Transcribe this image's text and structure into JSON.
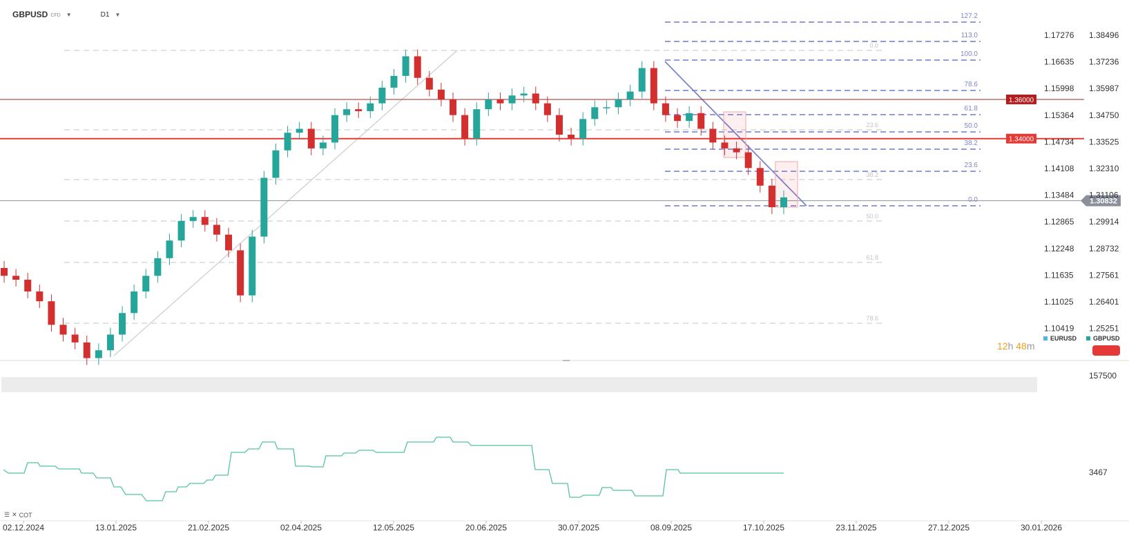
{
  "header": {
    "symbol": "GBPUSD",
    "symbol_suffix": "CFD",
    "timeframe": "D1"
  },
  "legend": [
    {
      "name": "EURUSD",
      "color": "#4fb3e8"
    },
    {
      "name": "GBPUSD",
      "color": "#26a69a"
    }
  ],
  "countdown": {
    "hours": "12",
    "hours_unit": "h",
    "minutes": "48",
    "minutes_unit": "m"
  },
  "price_scale_left": [
    "1.17276",
    "1.16635",
    "1.15998",
    "1.15364",
    "1.14734",
    "1.14108",
    "1.13484",
    "1.12865",
    "1.12248",
    "1.11635",
    "1.11025",
    "1.10419"
  ],
  "price_scale_right": [
    "1.38496",
    "1.37236",
    "1.35987",
    "1.34750",
    "1.33525",
    "1.32310",
    "1.31106",
    "1.29914",
    "1.28732",
    "1.27561",
    "1.26401",
    "1.25251"
  ],
  "price_labels": [
    {
      "text": "1.36000",
      "color": "#b71c1c"
    },
    {
      "text": "1.34000",
      "color": "#e53935"
    },
    {
      "text": "1.30832",
      "color": "#8a8f9a"
    }
  ],
  "fib_right": [
    "127.2",
    "113.0",
    "100.0",
    "78.6",
    "61.8",
    "50.0",
    "38.2",
    "23.6",
    "0.0"
  ],
  "fib_left": [
    "0.0",
    "23.6",
    "38.2",
    "50.0",
    "61.8",
    "78.6"
  ],
  "cot": {
    "label": "COT",
    "scale_values": [
      "157500",
      "3467"
    ]
  },
  "chart_data": {
    "type": "line",
    "title": "",
    "x_ticks": [
      "02.12.2024",
      "13.01.2025",
      "21.02.2025",
      "02.04.2025",
      "12.05.2025",
      "20.06.2025",
      "30.07.2025",
      "08.09.2025",
      "17.10.2025",
      "23.11.2025",
      "27.12.2025",
      "30.01.2026"
    ],
    "ylim": [
      1.25,
      1.39
    ],
    "horizontal_levels": [
      1.36,
      1.34,
      1.30832
    ],
    "series": [
      {
        "name": "GBPUSD",
        "values": [
          1.27,
          1.268,
          1.262,
          1.257,
          1.245,
          1.24,
          1.236,
          1.228,
          1.232,
          1.24,
          1.251,
          1.262,
          1.27,
          1.279,
          1.288,
          1.298,
          1.3,
          1.296,
          1.291,
          1.283,
          1.26,
          1.29,
          1.32,
          1.334,
          1.343,
          1.345,
          1.335,
          1.338,
          1.352,
          1.355,
          1.354,
          1.358,
          1.366,
          1.372,
          1.382,
          1.371,
          1.365,
          1.36,
          1.352,
          1.34,
          1.355,
          1.36,
          1.358,
          1.362,
          1.363,
          1.358,
          1.352,
          1.342,
          1.34,
          1.35,
          1.356,
          1.356,
          1.36,
          1.364,
          1.376,
          1.358,
          1.352,
          1.349,
          1.353,
          1.345,
          1.338,
          1.335,
          1.333,
          1.325,
          1.316,
          1.305,
          1.31
        ]
      }
    ]
  }
}
